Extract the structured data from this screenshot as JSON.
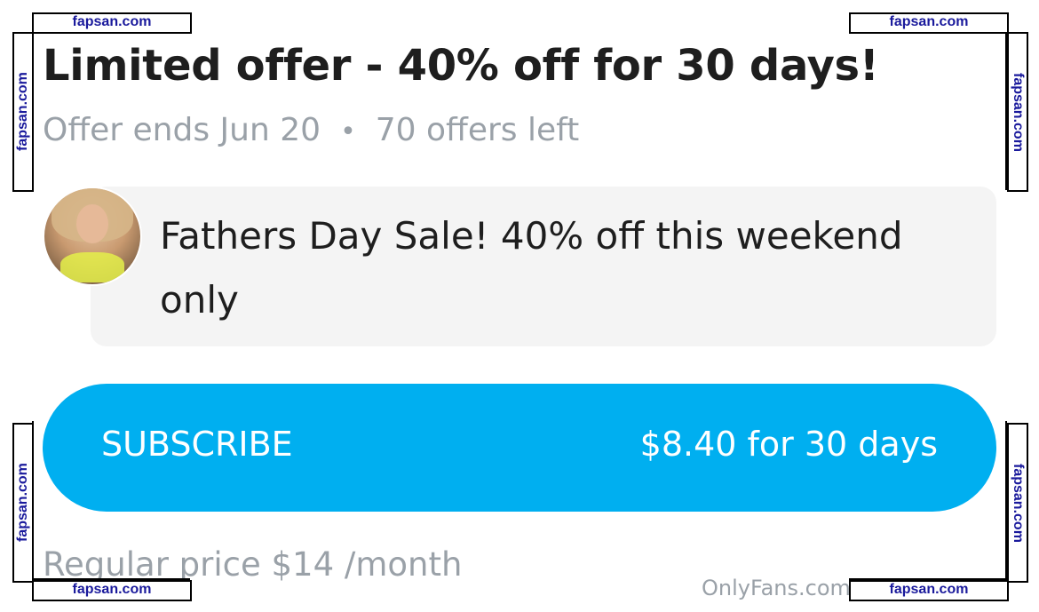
{
  "offer": {
    "title": "Limited offer - 40% off for 30 days!",
    "ends": "Offer ends Jun 20",
    "separator": "•",
    "remaining": "70 offers left"
  },
  "message": {
    "text": "Fathers Day Sale! 40% off this weekend only"
  },
  "subscribe": {
    "label": "SUBSCRIBE",
    "price": "$8.40 for 30 days",
    "color": "#00aff0"
  },
  "regular_price": "Regular price $14 /month",
  "footer_brand": "OnlyFans.com",
  "watermark": "fapsan.com"
}
